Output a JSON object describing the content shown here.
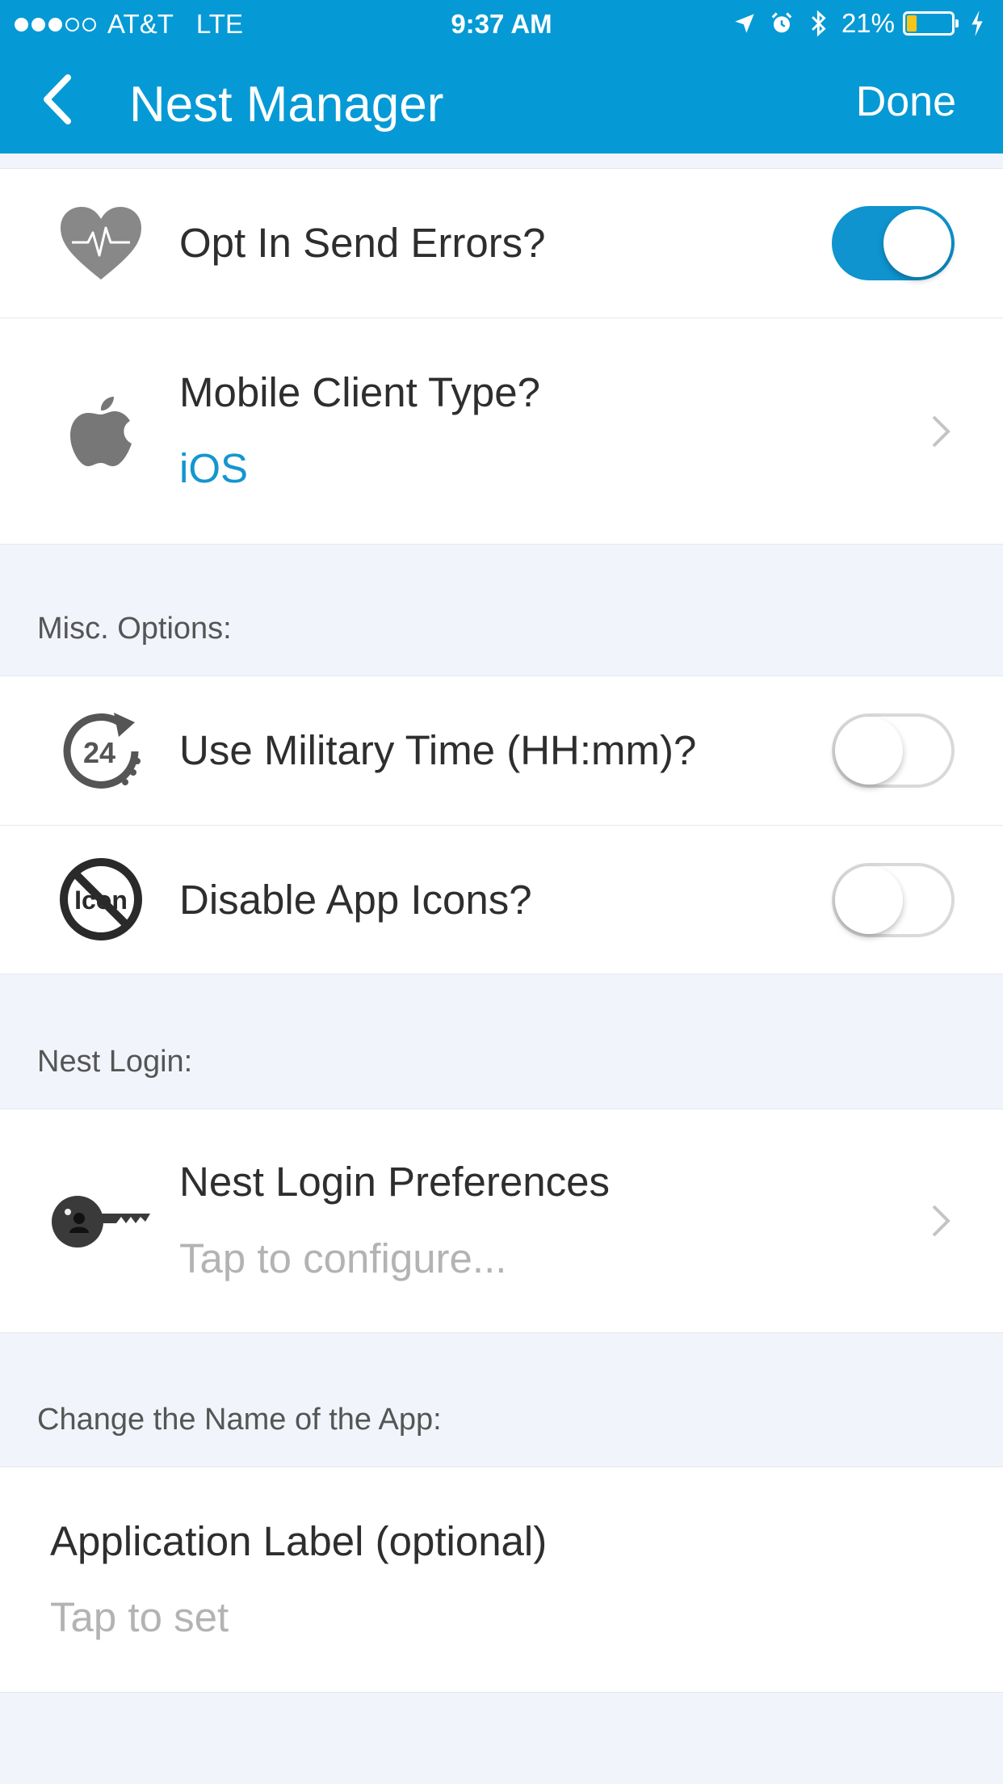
{
  "status_bar": {
    "carrier": "AT&T",
    "network": "LTE",
    "time": "9:37 AM",
    "battery_percent": "21%",
    "signal_bars_filled": 3,
    "signal_bars_total": 5
  },
  "nav": {
    "title": "Nest Manager",
    "done_label": "Done"
  },
  "rows": {
    "send_errors": {
      "label": "Opt In Send Errors?",
      "toggle_on": true
    },
    "mobile_client": {
      "label": "Mobile Client Type?",
      "value": "iOS"
    },
    "military_time": {
      "label": "Use Military Time (HH:mm)?",
      "toggle_on": false
    },
    "disable_icons": {
      "label": "Disable App Icons?",
      "toggle_on": false
    },
    "nest_login": {
      "label": "Nest Login Preferences",
      "value": "Tap to configure..."
    },
    "app_label": {
      "label": "Application Label (optional)",
      "value": "Tap to set"
    }
  },
  "sections": {
    "misc": "Misc. Options:",
    "login": "Nest Login:",
    "rename": "Change the Name of the App:"
  },
  "icon_text": {
    "clock_24": "24",
    "no_icon": "Icon"
  },
  "colors": {
    "brand_blue": "#059ad5",
    "toggle_on": "#0f94cf",
    "value_blue": "#1596cf",
    "background": "#f1f5fb"
  },
  "icons": [
    "back-chevron-icon",
    "location-icon",
    "alarm-icon",
    "bluetooth-icon",
    "battery-icon",
    "charging-icon",
    "heartbeat-icon",
    "apple-icon",
    "clock-24-icon",
    "no-icon-icon",
    "key-user-icon",
    "chevron-right-icon"
  ]
}
